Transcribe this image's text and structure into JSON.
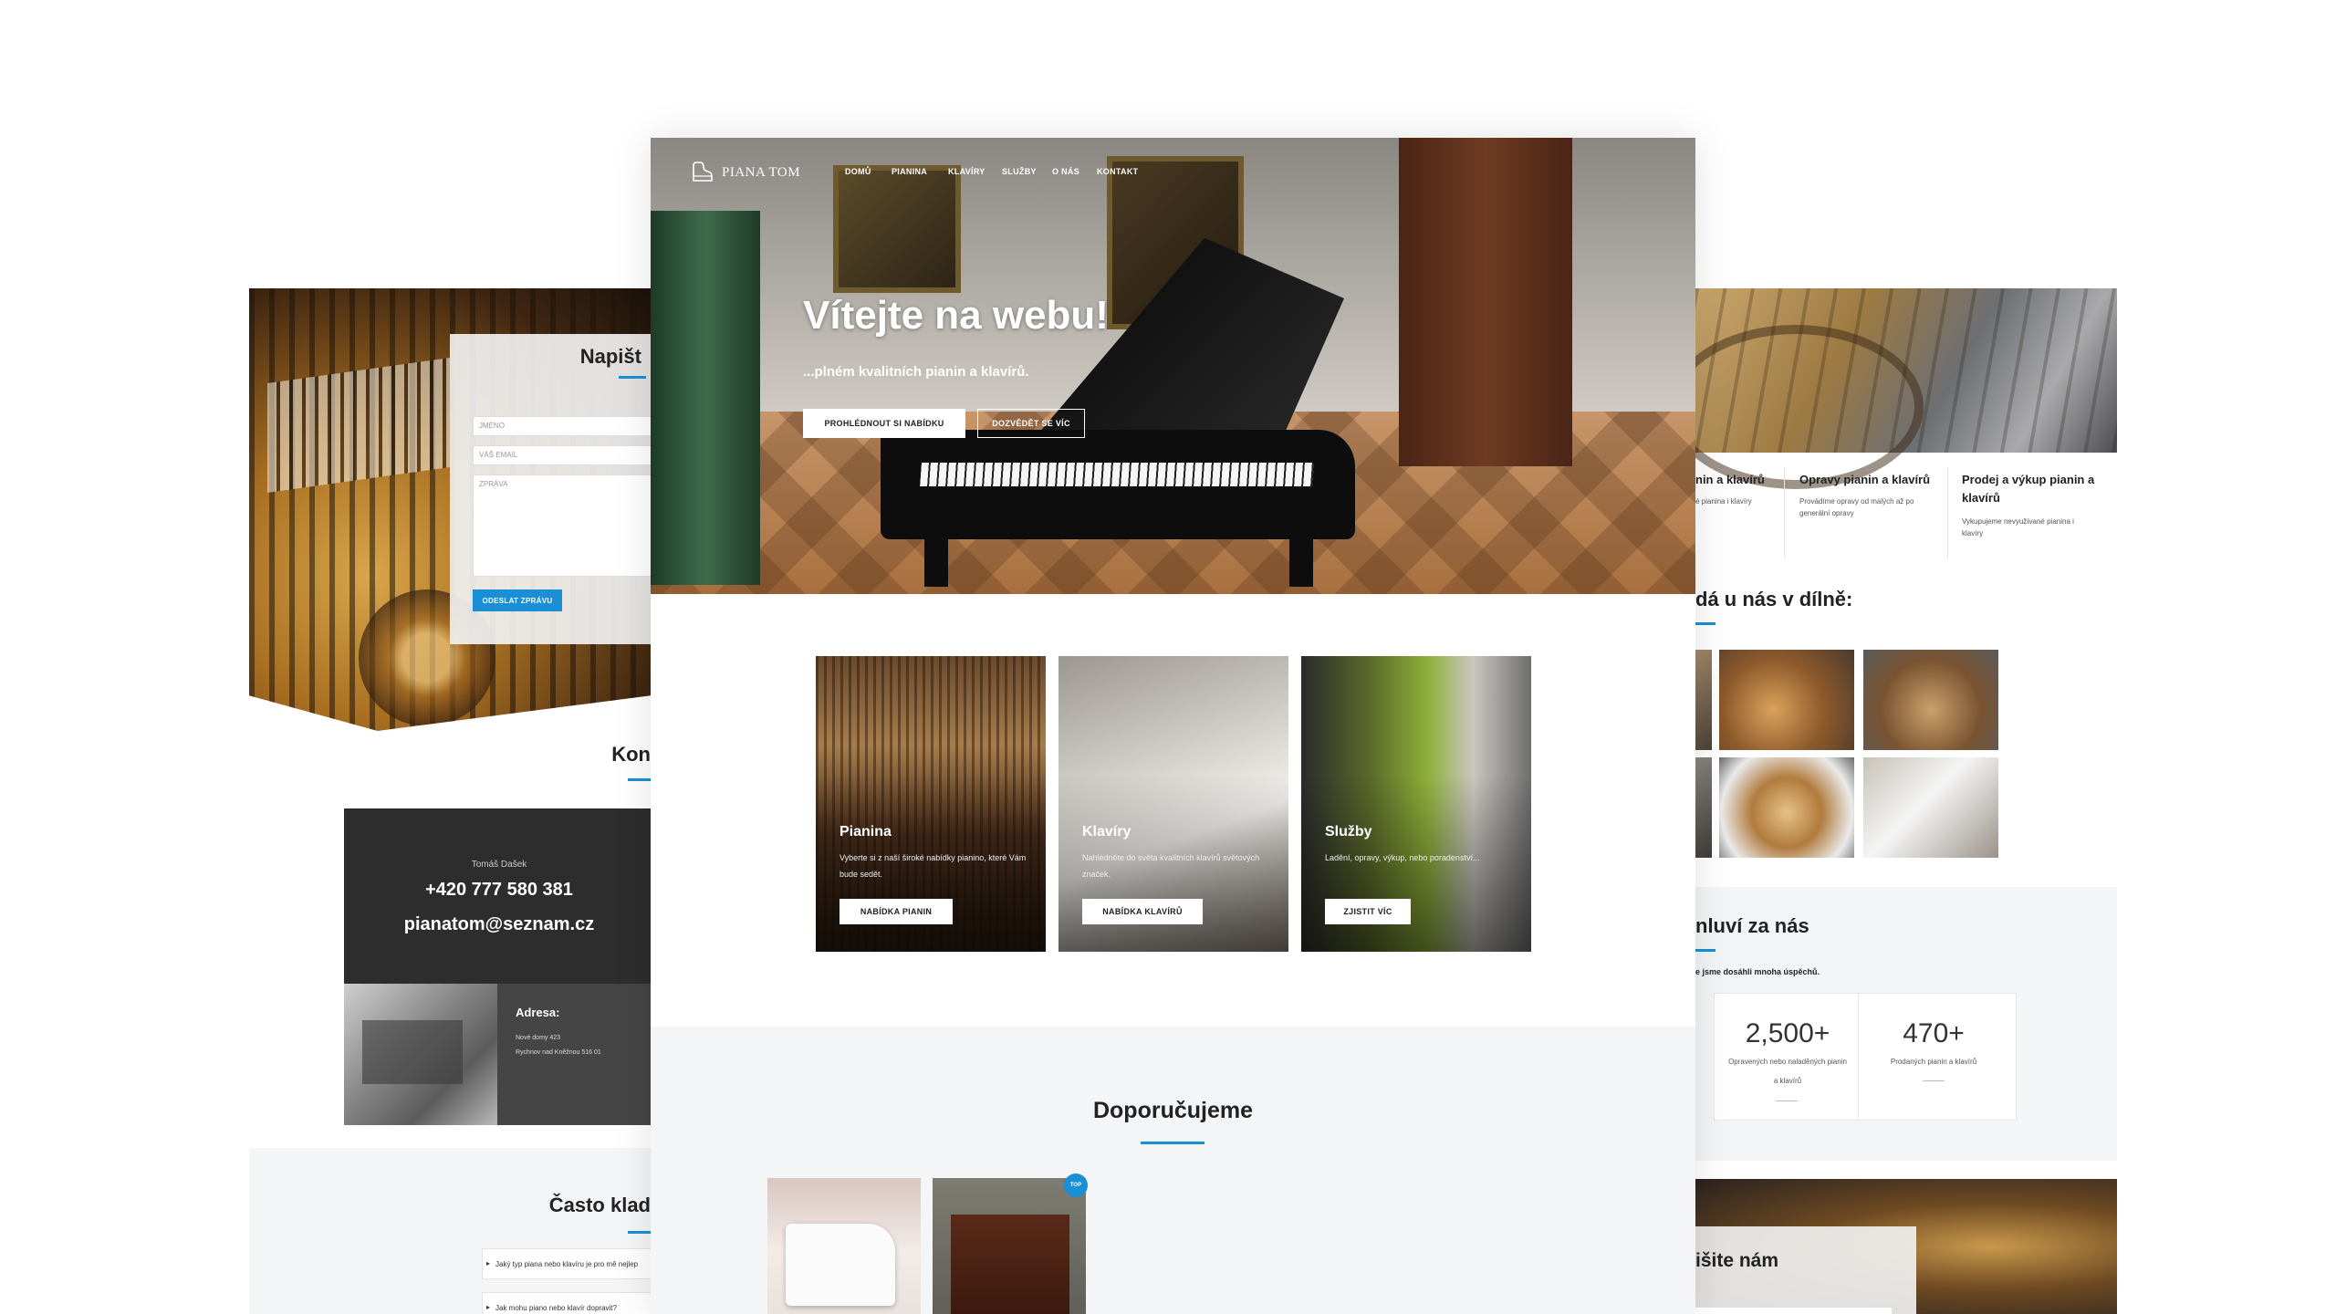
{
  "left_panel": {
    "form_title": "Napišt",
    "name_placeholder": "JMÉNO",
    "email_placeholder": "VÁŠ EMAIL",
    "message_placeholder": "ZPRÁVA",
    "send_label": "ODESLAT ZPRÁVU",
    "contact_title": "Kon",
    "contact_name": "Tomáš Dašek",
    "phone": "+420 777 580 381",
    "email": "pianatom@seznam.cz",
    "address_heading": "Adresa:",
    "address_line1": "Nové domy 423",
    "address_line2": "Rychnov nad Kněžnou 516 01",
    "faq_title": "Často klad",
    "faq": [
      "Jaký typ piana nebo klavíru je pro mě nejlep",
      "Jak mohu piano nebo klavír dopravit?"
    ]
  },
  "center_panel": {
    "logo": "PIANA TOM",
    "menu": [
      "DOMŮ",
      "PIANINA",
      "KLAVÍRY",
      "SLUŽBY",
      "O NÁS",
      "KONTAKT"
    ],
    "hero_title": "Vítejte na webu!",
    "hero_subtitle": "...plném kvalitních pianin a klavírů.",
    "hero_btn_primary": "PROHLÉDNOUT SI NABÍDKU",
    "hero_btn_secondary": "DOZVĚDĚT SE VÍC",
    "tiles": [
      {
        "title": "Pianina",
        "text": "Vyberte si z naší široké nabídky pianino, které Vám bude sedět.",
        "button": "NABÍDKA PIANIN"
      },
      {
        "title": "Klavíry",
        "text": "Nahlédněte do světa kvalitních klavírů světových značek.",
        "button": "NABÍDKA KLAVÍRŮ"
      },
      {
        "title": "Služby",
        "text": "Ladění, opravy, výkup, nebo poradenství...",
        "button": "ZJISTIT VÍC"
      }
    ],
    "recommend_title": "Doporučujeme",
    "badge": "TOP"
  },
  "right_panel": {
    "services": [
      {
        "title": "nin a klavírů",
        "text": "é pianina i klavíry"
      },
      {
        "title": "Opravy pianin a klavírů",
        "text": "Provádíme opravy od malých až po generální opravy"
      },
      {
        "title": "Prodej a výkup pianin a klavírů",
        "text": "Vykupujeme nevyužívané pianina i klavíry"
      }
    ],
    "workshop_title": "dá u nás v dílně:",
    "stats_title": "nluví za nás",
    "stats_subtitle": "e jsme dosáhli mnoha úspěchů.",
    "stats": [
      {
        "value": "2,500+",
        "label": "Opravených nebo naladěných pianin a klavírů"
      },
      {
        "value": "470+",
        "label": "Prodaných pianin a klavírů"
      }
    ],
    "write_title": "išite nám"
  }
}
